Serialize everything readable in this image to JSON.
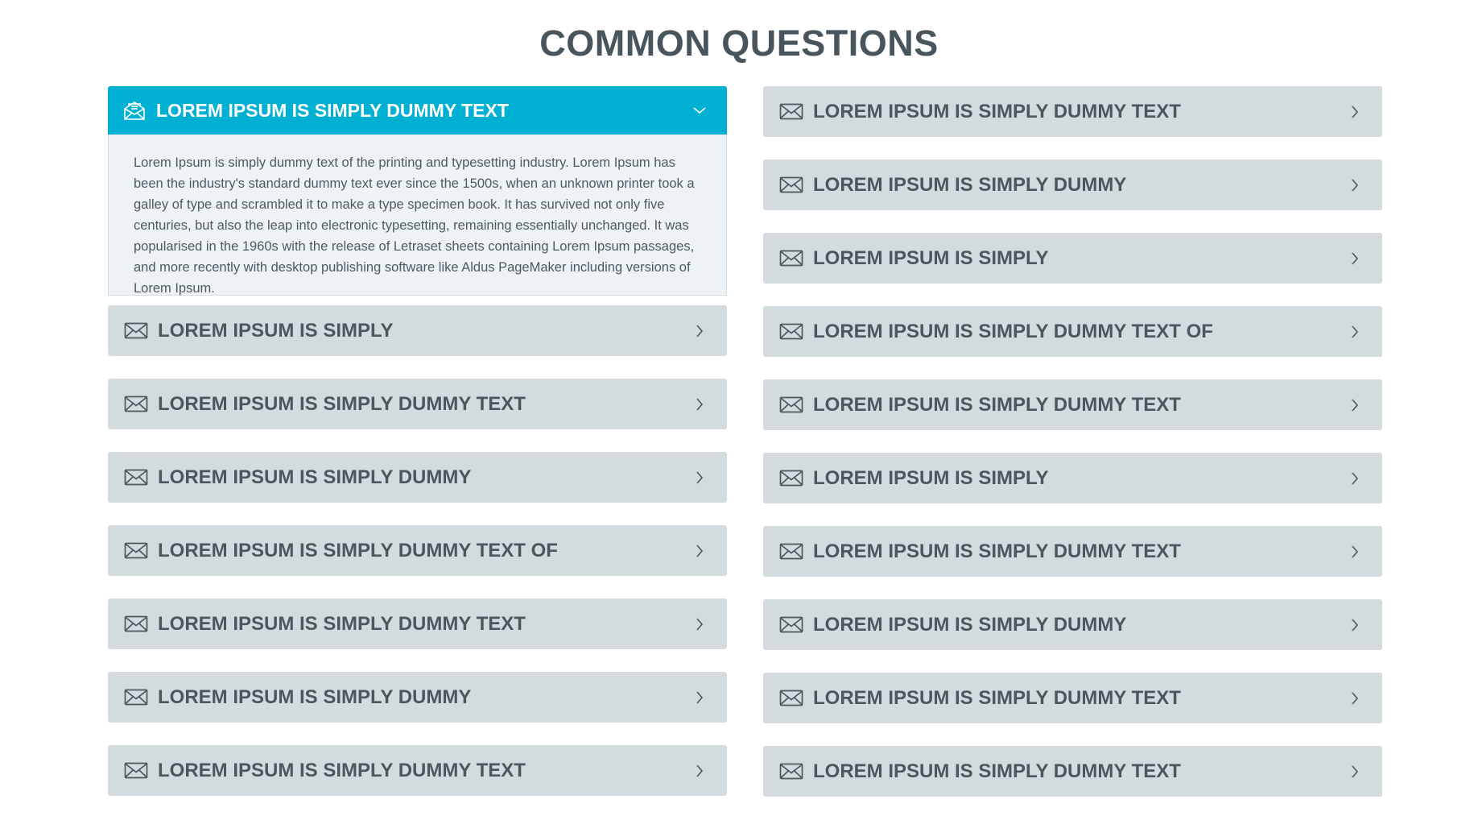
{
  "page": {
    "title": "COMMON QUESTIONS"
  },
  "colors": {
    "accent": "#00b0d3",
    "item_bg": "#d4dbde",
    "text": "#4b575e",
    "panel_bg": "#ecf2f5"
  },
  "left": {
    "open_item": {
      "label": "LOREM IPSUM IS SIMPLY DUMMY TEXT",
      "icon": "open-envelope-icon",
      "answer": "Lorem Ipsum is simply dummy text of the printing and typesetting industry. Lorem Ipsum has been the industry's standard dummy text ever since the 1500s, when an unknown printer took a galley of type and scrambled it to make a type specimen book. It has survived not only five centuries, but also the leap into electronic typesetting, remaining essentially unchanged.  It was popularised in the 1960s with the release of Letraset sheets containing Lorem Ipsum passages, and more recently with desktop publishing software like Aldus PageMaker including versions of Lorem Ipsum."
    },
    "items": [
      {
        "label": "LOREM IPSUM IS SIMPLY"
      },
      {
        "label": "LOREM IPSUM IS SIMPLY DUMMY TEXT"
      },
      {
        "label": "LOREM IPSUM IS SIMPLY DUMMY"
      },
      {
        "label": "LOREM IPSUM IS SIMPLY DUMMY TEXT OF"
      },
      {
        "label": "LOREM IPSUM IS SIMPLY DUMMY TEXT"
      },
      {
        "label": "LOREM IPSUM IS SIMPLY DUMMY"
      },
      {
        "label": "LOREM IPSUM IS SIMPLY DUMMY TEXT"
      }
    ]
  },
  "right": {
    "items": [
      {
        "label": "LOREM IPSUM IS SIMPLY DUMMY TEXT"
      },
      {
        "label": "LOREM IPSUM IS SIMPLY DUMMY"
      },
      {
        "label": "LOREM IPSUM IS SIMPLY"
      },
      {
        "label": "LOREM IPSUM IS SIMPLY DUMMY TEXT OF"
      },
      {
        "label": "LOREM IPSUM IS SIMPLY DUMMY TEXT"
      },
      {
        "label": "LOREM IPSUM IS SIMPLY"
      },
      {
        "label": "LOREM IPSUM IS SIMPLY DUMMY TEXT"
      },
      {
        "label": "LOREM IPSUM IS SIMPLY DUMMY"
      },
      {
        "label": "LOREM IPSUM IS SIMPLY DUMMY TEXT"
      },
      {
        "label": "LOREM IPSUM IS SIMPLY DUMMY TEXT"
      }
    ]
  }
}
